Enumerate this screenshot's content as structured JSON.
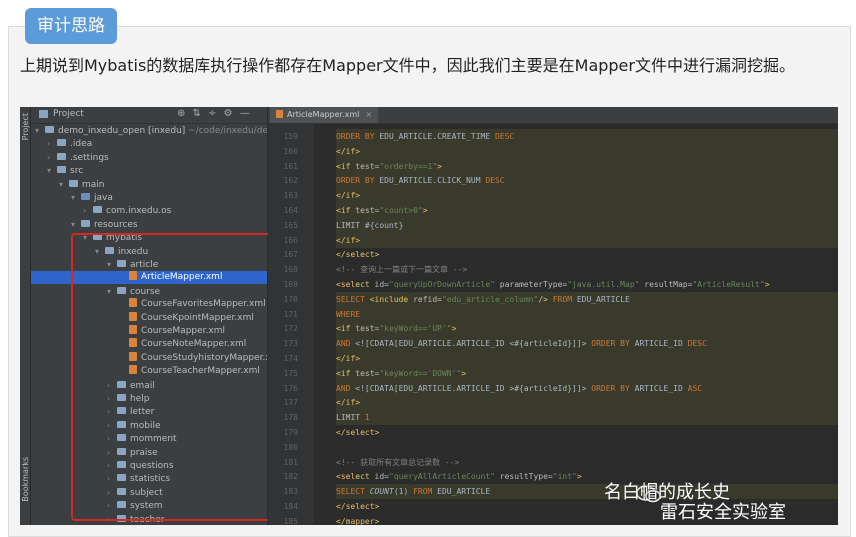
{
  "section_badge": "审计思路",
  "paragraph": "上期说到Mybatis的数据库执行操作都存在Mapper文件中，因此我们主要是在Mapper文件中进行漏洞挖掘。",
  "ide": {
    "side_strip": {
      "project": "Project",
      "bookmarks": "Bookmarks"
    },
    "panel_title": "Project",
    "panel_icons": "⊕ ⇅ ÷ ⚙ —",
    "tab": {
      "label": "ArticleMapper.xml",
      "close": "×"
    },
    "tree": [
      {
        "indent": 0,
        "arrow": "▾",
        "type": "folder",
        "label": "demo_inxedu_open [inxedu]",
        "suffix": "~/code/inxedu/demo"
      },
      {
        "indent": 1,
        "arrow": "›",
        "type": "folder",
        "label": ".idea"
      },
      {
        "indent": 1,
        "arrow": "›",
        "type": "folder",
        "label": ".settings"
      },
      {
        "indent": 1,
        "arrow": "▾",
        "type": "folder",
        "label": "src"
      },
      {
        "indent": 2,
        "arrow": "▾",
        "type": "folder",
        "label": "main"
      },
      {
        "indent": 3,
        "arrow": "▾",
        "type": "src",
        "label": "java"
      },
      {
        "indent": 4,
        "arrow": "›",
        "type": "folder",
        "label": "com.inxedu.os"
      },
      {
        "indent": 3,
        "arrow": "▾",
        "type": "folder",
        "label": "resources"
      },
      {
        "indent": 4,
        "arrow": "▾",
        "type": "folder",
        "label": "mybatis"
      },
      {
        "indent": 5,
        "arrow": "▾",
        "type": "folder",
        "label": "inxedu"
      },
      {
        "indent": 6,
        "arrow": "▾",
        "type": "folder",
        "label": "article"
      },
      {
        "indent": 7,
        "arrow": "",
        "type": "xml",
        "label": "ArticleMapper.xml",
        "selected": true
      },
      {
        "indent": 6,
        "arrow": "▾",
        "type": "folder",
        "label": "course"
      },
      {
        "indent": 7,
        "arrow": "",
        "type": "xml",
        "label": "CourseFavoritesMapper.xml"
      },
      {
        "indent": 7,
        "arrow": "",
        "type": "xml",
        "label": "CourseKpointMapper.xml"
      },
      {
        "indent": 7,
        "arrow": "",
        "type": "xml",
        "label": "CourseMapper.xml"
      },
      {
        "indent": 7,
        "arrow": "",
        "type": "xml",
        "label": "CourseNoteMapper.xml"
      },
      {
        "indent": 7,
        "arrow": "",
        "type": "xml",
        "label": "CourseStudyhistoryMapper.xml"
      },
      {
        "indent": 7,
        "arrow": "",
        "type": "xml",
        "label": "CourseTeacherMapper.xml"
      },
      {
        "indent": 6,
        "arrow": "›",
        "type": "folder",
        "label": "email"
      },
      {
        "indent": 6,
        "arrow": "›",
        "type": "folder",
        "label": "help"
      },
      {
        "indent": 6,
        "arrow": "›",
        "type": "folder",
        "label": "letter"
      },
      {
        "indent": 6,
        "arrow": "›",
        "type": "folder",
        "label": "mobile"
      },
      {
        "indent": 6,
        "arrow": "›",
        "type": "folder",
        "label": "momment"
      },
      {
        "indent": 6,
        "arrow": "›",
        "type": "folder",
        "label": "praise"
      },
      {
        "indent": 6,
        "arrow": "›",
        "type": "folder",
        "label": "questions"
      },
      {
        "indent": 6,
        "arrow": "›",
        "type": "folder",
        "label": "statistics"
      },
      {
        "indent": 6,
        "arrow": "›",
        "type": "folder",
        "label": "subject"
      },
      {
        "indent": 6,
        "arrow": "›",
        "type": "folder",
        "label": "system"
      },
      {
        "indent": 6,
        "arrow": "›",
        "type": "folder",
        "label": "teacher"
      }
    ],
    "code": [
      {
        "n": "159",
        "hl": true,
        "segs": [
          [
            "kw",
            "ORDER BY "
          ],
          [
            "",
            "EDU_ARTICLE.CREATE_TIME "
          ],
          [
            "kw",
            "DESC"
          ]
        ]
      },
      {
        "n": "160",
        "hl": true,
        "segs": [
          [
            "tg",
            "</if>"
          ]
        ]
      },
      {
        "n": "161",
        "hl": true,
        "segs": [
          [
            "tg",
            "<if "
          ],
          [
            "at",
            "test="
          ],
          [
            "st",
            "\"orderby==1\""
          ],
          [
            "tg",
            ">"
          ]
        ]
      },
      {
        "n": "162",
        "hl": true,
        "segs": [
          [
            "kw",
            "ORDER BY "
          ],
          [
            "",
            "EDU_ARTICLE.CLICK_NUM "
          ],
          [
            "kw",
            "DESC"
          ]
        ]
      },
      {
        "n": "163",
        "hl": true,
        "segs": [
          [
            "tg",
            "</if>"
          ]
        ]
      },
      {
        "n": "164",
        "hl": true,
        "segs": [
          [
            "tg",
            "<if "
          ],
          [
            "at",
            "test="
          ],
          [
            "st",
            "\"count>0\""
          ],
          [
            "tg",
            ">"
          ]
        ]
      },
      {
        "n": "165",
        "hl": true,
        "segs": [
          [
            "",
            "LIMIT #{count}"
          ]
        ]
      },
      {
        "n": "166",
        "hl": true,
        "segs": [
          [
            "tg",
            "</if>"
          ]
        ]
      },
      {
        "n": "167",
        "hl": false,
        "segs": [
          [
            "tg",
            "</select>"
          ]
        ]
      },
      {
        "n": "168",
        "hl": false,
        "segs": [
          [
            "cm",
            "<!-- 查询上一篇或下一篇文章 -->"
          ]
        ]
      },
      {
        "n": "169",
        "hl": false,
        "segs": [
          [
            "tg",
            "<select "
          ],
          [
            "at",
            "id="
          ],
          [
            "st",
            "\"queryUpOrDownArticle\" "
          ],
          [
            "at",
            "parameterType="
          ],
          [
            "st",
            "\"java.util.Map\" "
          ],
          [
            "at",
            "resultMap="
          ],
          [
            "st",
            "\"ArticleResult\""
          ],
          [
            "tg",
            ">"
          ]
        ]
      },
      {
        "n": "170",
        "hl": true,
        "segs": [
          [
            "kw",
            "SELECT "
          ],
          [
            "tg",
            "<include "
          ],
          [
            "at",
            "refid="
          ],
          [
            "st",
            "\"edu_article_column\""
          ],
          [
            "tg",
            "/> "
          ],
          [
            "kw",
            "FROM "
          ],
          [
            "",
            "EDU_ARTICLE"
          ]
        ]
      },
      {
        "n": "171",
        "hl": true,
        "segs": [
          [
            "kw",
            "WHERE"
          ]
        ]
      },
      {
        "n": "172",
        "hl": true,
        "segs": [
          [
            "tg",
            "<if "
          ],
          [
            "at",
            "test="
          ],
          [
            "st",
            "\"keyWord=='UP'\""
          ],
          [
            "tg",
            ">"
          ]
        ]
      },
      {
        "n": "173",
        "hl": true,
        "segs": [
          [
            "kw",
            "AND "
          ],
          [
            "",
            "<![CDATA[EDU_ARTICLE.ARTICLE_ID <#{articleId}]]> "
          ],
          [
            "kw",
            "ORDER BY "
          ],
          [
            "",
            "ARTICLE_ID "
          ],
          [
            "kw",
            "DESC"
          ]
        ]
      },
      {
        "n": "174",
        "hl": true,
        "segs": [
          [
            "tg",
            "</if>"
          ]
        ]
      },
      {
        "n": "175",
        "hl": true,
        "segs": [
          [
            "tg",
            "<if "
          ],
          [
            "at",
            "test="
          ],
          [
            "st",
            "\"keyWord=='DOWN'\""
          ],
          [
            "tg",
            ">"
          ]
        ]
      },
      {
        "n": "176",
        "hl": true,
        "segs": [
          [
            "kw",
            "AND "
          ],
          [
            "",
            "<![CDATA[EDU_ARTICLE.ARTICLE_ID >#{articleId}]]> "
          ],
          [
            "kw",
            "ORDER BY "
          ],
          [
            "",
            "ARTICLE_ID "
          ],
          [
            "kw",
            "ASC"
          ]
        ]
      },
      {
        "n": "177",
        "hl": true,
        "segs": [
          [
            "tg",
            "</if>"
          ]
        ]
      },
      {
        "n": "178",
        "hl": true,
        "segs": [
          [
            "",
            "LIMIT "
          ],
          [
            "kw",
            "1"
          ]
        ]
      },
      {
        "n": "179",
        "hl": false,
        "segs": [
          [
            "tg",
            "</select>"
          ]
        ]
      },
      {
        "n": "180",
        "hl": false,
        "segs": []
      },
      {
        "n": "181",
        "hl": false,
        "segs": [
          [
            "cm",
            "<!-- 获取所有文章总记录数 -->"
          ]
        ]
      },
      {
        "n": "182",
        "hl": false,
        "segs": [
          [
            "tg",
            "<select "
          ],
          [
            "at",
            "id="
          ],
          [
            "st",
            "\"queryAllArticleCount\" "
          ],
          [
            "at",
            "resultType="
          ],
          [
            "st",
            "\"int\""
          ],
          [
            "tg",
            ">"
          ]
        ]
      },
      {
        "n": "183",
        "hl": true,
        "segs": [
          [
            "kw",
            "SELECT "
          ],
          [
            "it",
            "COUNT"
          ],
          [
            "",
            "(1) "
          ],
          [
            "kw",
            "FROM "
          ],
          [
            "",
            "EDU_ARTICLE"
          ]
        ]
      },
      {
        "n": "184",
        "hl": false,
        "segs": [
          [
            "tg",
            "</select>"
          ]
        ]
      },
      {
        "n": "185",
        "hl": false,
        "segs": [
          [
            "tg",
            "</mapper>"
          ]
        ]
      }
    ]
  },
  "watermark": {
    "line1": "名白帽的成长史",
    "line2": "雷石安全实验室"
  }
}
